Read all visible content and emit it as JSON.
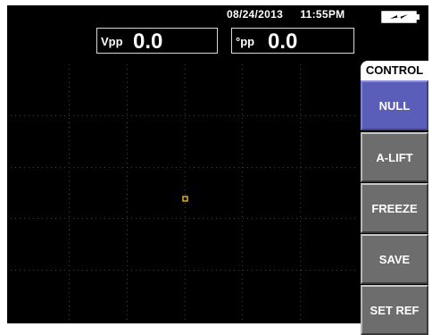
{
  "status_bar": {
    "date": "08/24/2013",
    "time": "11:55PM",
    "battery_icon": "battery-charging-icon"
  },
  "readouts": {
    "vpp": {
      "label": "Vpp",
      "value": "0.0"
    },
    "phase": {
      "label": "°pp",
      "value": "0.0"
    }
  },
  "display": {
    "marker_icon": "signal-dot-icon",
    "marker_color": "#e0b020",
    "grid_color": "#404040"
  },
  "menu": {
    "title": "CONTROL",
    "items": [
      {
        "label": "NULL",
        "active": true
      },
      {
        "label": "A-LIFT",
        "active": false
      },
      {
        "label": "FREEZE",
        "active": false
      },
      {
        "label": "SAVE",
        "active": false
      },
      {
        "label": "SET REF",
        "active": false
      }
    ]
  },
  "colors": {
    "background": "#000000",
    "menu_active": "#5b5eb8",
    "menu_inactive": "#6d6d6d"
  }
}
